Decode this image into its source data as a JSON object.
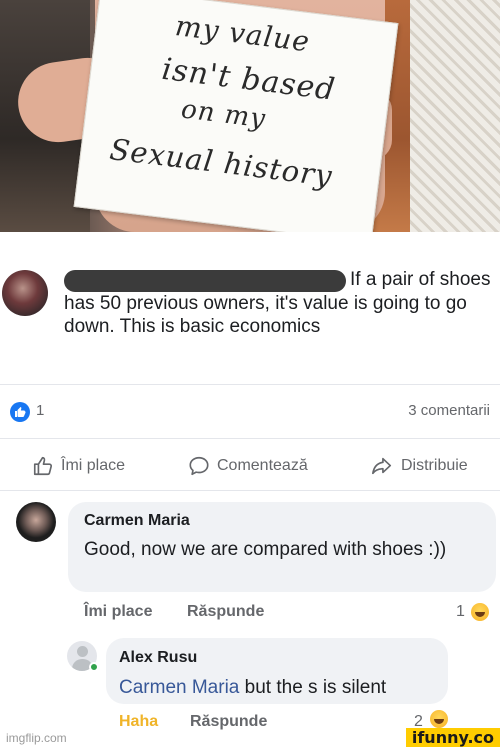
{
  "photo": {
    "sign_lines": [
      "my value",
      "isn't based",
      "on my",
      "Sexual history"
    ]
  },
  "post": {
    "text_after_redaction": "If a pair of shoes has 50 previous owners, it's value is going to go down. This is basic economics",
    "reaction_count": "1",
    "comments_count": "3 comentarii"
  },
  "actions": {
    "like_label": "Îmi place",
    "comment_label": "Comentează",
    "share_label": "Distribuie"
  },
  "comments": [
    {
      "author": "Carmen Maria",
      "text": "Good, now we are compared with shoes :))",
      "like_label": "Îmi place",
      "reply_label": "Răspunde",
      "reaction_count": "1"
    },
    {
      "author": "Alex Rusu",
      "mention": "Carmen Maria",
      "text": " but the s is silent",
      "reaction_label": "Haha",
      "reply_label": "Răspunde",
      "reaction_count": "2"
    }
  ],
  "icons": {
    "like": "thumbs-up-icon",
    "comment": "comment-bubble-icon",
    "share": "share-arrow-icon",
    "reaction": "haha-emoji-icon"
  },
  "colors": {
    "facebook_blue": "#1877f2",
    "haha_yellow": "#f0b429",
    "mention": "#385898",
    "bubble_bg": "#f0f2f5"
  },
  "watermarks": {
    "imgflip": "imgflip.com",
    "ifunny": "ifunny.co"
  }
}
